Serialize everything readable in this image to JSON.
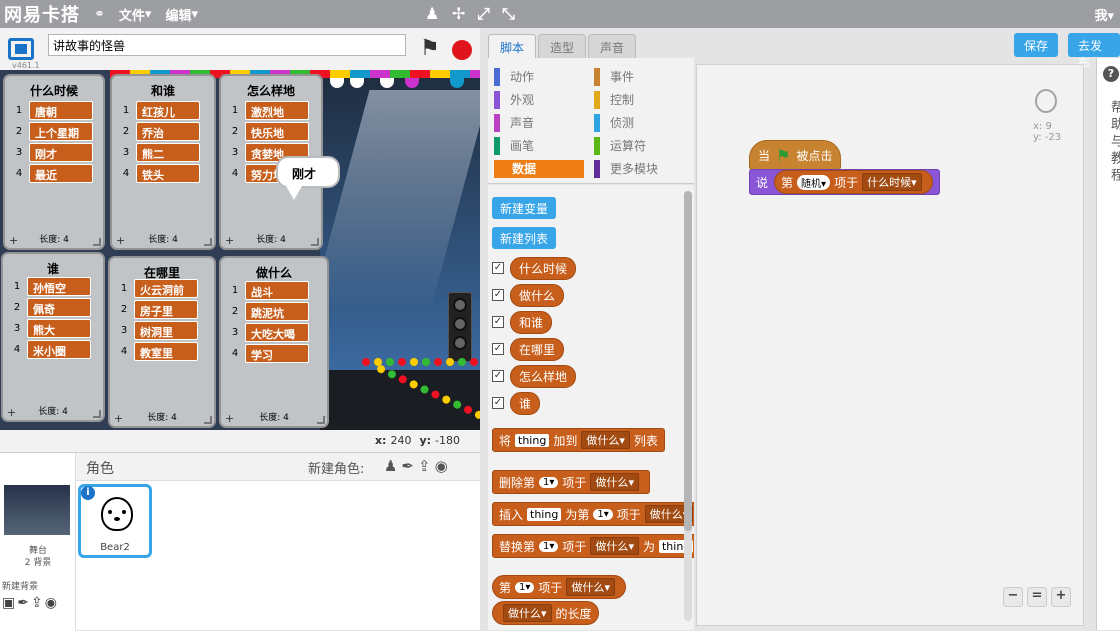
{
  "topbar": {
    "logo": "网易卡搭",
    "menus": [
      "文件",
      "编辑"
    ],
    "user": "我"
  },
  "stage": {
    "version": "v461.1",
    "project_title": "讲故事的怪兽",
    "bubble": "刚才",
    "coords": {
      "x_label": "x:",
      "x": "240",
      "y_label": "y:",
      "y": "-180"
    },
    "lists": [
      {
        "title": "什么时候",
        "items": [
          "唐朝",
          "上个星期",
          "刚才",
          "最近"
        ],
        "length": "长度: 4"
      },
      {
        "title": "和谁",
        "items": [
          "红孩儿",
          "乔治",
          "熊二",
          "铁头"
        ],
        "length": "长度: 4"
      },
      {
        "title": "怎么样地",
        "items": [
          "激烈地",
          "快乐地",
          "贪婪地",
          "努力地"
        ],
        "length": "长度: 4"
      },
      {
        "title": "谁",
        "items": [
          "孙悟空",
          "佩奇",
          "熊大",
          "米小圈"
        ],
        "length": "长度: 4"
      },
      {
        "title": "在哪里",
        "items": [
          "火云洞前",
          "房子里",
          "树洞里",
          "教室里"
        ],
        "length": "长度: 4"
      },
      {
        "title": "做什么",
        "items": [
          "战斗",
          "跳泥坑",
          "大吃大喝",
          "学习"
        ],
        "length": "长度: 4"
      }
    ]
  },
  "sprites": {
    "title": "角色",
    "new_sprite": "新建角色:",
    "stage_label": "舞台",
    "stage_backdrops": "2 背景",
    "new_backdrop": "新建背景",
    "sprite_name": "Bear2"
  },
  "palette": {
    "tabs": [
      "脚本",
      "造型",
      "声音"
    ],
    "categories": [
      {
        "label": "动作",
        "color": "#4a6cd4"
      },
      {
        "label": "事件",
        "color": "#c88330"
      },
      {
        "label": "外观",
        "color": "#8a55d7"
      },
      {
        "label": "控制",
        "color": "#e1a91a"
      },
      {
        "label": "声音",
        "color": "#bb42c3"
      },
      {
        "label": "侦测",
        "color": "#2ca5e2"
      },
      {
        "label": "画笔",
        "color": "#0e9a6c"
      },
      {
        "label": "运算符",
        "color": "#5cb712"
      },
      {
        "label": "数据",
        "color": "#ee7d16"
      },
      {
        "label": "更多模块",
        "color": "#632d99"
      }
    ],
    "new_var": "新建变量",
    "new_list": "新建列表",
    "reporters": [
      "什么时候",
      "做什么",
      "和谁",
      "在哪里",
      "怎么样地",
      "谁"
    ],
    "blocks": {
      "add": {
        "a": "将",
        "thing": "thing",
        "b": "加到",
        "list": "做什么",
        "c": "列表"
      },
      "delete": {
        "a": "删除第",
        "n": "1",
        "b": "项于",
        "list": "做什么"
      },
      "insert": {
        "a": "插入",
        "thing": "thing",
        "b": "为第",
        "n": "1",
        "c": "项于",
        "list": "做什么"
      },
      "replace": {
        "a": "替换第",
        "n": "1",
        "b": "项于",
        "list": "做什么",
        "c": "为",
        "thing": "thing"
      },
      "item": {
        "a": "第",
        "n": "1",
        "b": "项于",
        "list": "做什么"
      },
      "length": {
        "list": "做什么",
        "a": "的长度"
      }
    }
  },
  "editor": {
    "save": "保存",
    "publish": "去发布",
    "hat": {
      "a": "当",
      "b": "被点击"
    },
    "say": {
      "a": "说",
      "b": "第",
      "which": "随机",
      "c": "项于",
      "list": "什么时候"
    },
    "sprite_x": "x: 9",
    "sprite_y": "y: -23",
    "help": "帮助与教程"
  },
  "colors": {
    "data": "#c85e1b",
    "event": "#c88330",
    "looks": "#8a55d7",
    "accent": "#37a5e8"
  }
}
